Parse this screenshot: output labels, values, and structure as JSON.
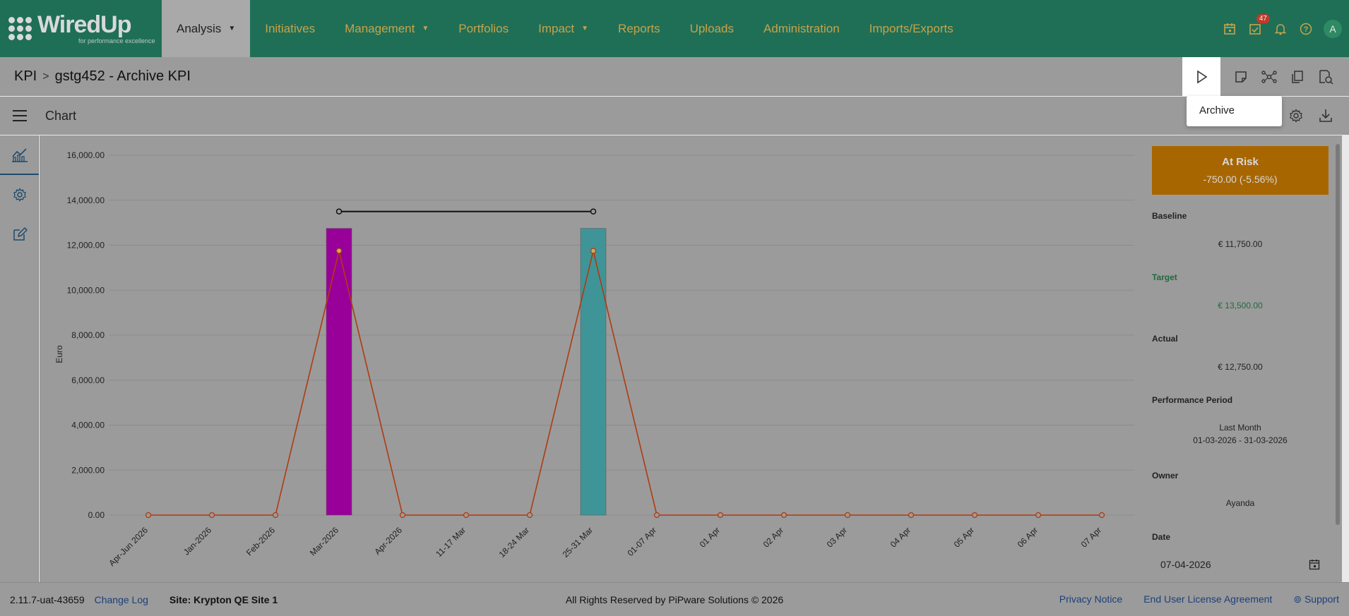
{
  "nav": {
    "logo_main": "WiredUp",
    "logo_sub": "for performance excellence",
    "items": [
      {
        "label": "Analysis",
        "dropdown": true,
        "active": true
      },
      {
        "label": "Initiatives",
        "dropdown": false
      },
      {
        "label": "Management",
        "dropdown": true
      },
      {
        "label": "Portfolios",
        "dropdown": false
      },
      {
        "label": "Impact",
        "dropdown": true
      },
      {
        "label": "Reports",
        "dropdown": false
      },
      {
        "label": "Uploads",
        "dropdown": false
      },
      {
        "label": "Administration",
        "dropdown": false
      },
      {
        "label": "Imports/Exports",
        "dropdown": false
      }
    ],
    "icons": [
      "calendar-icon",
      "task-icon",
      "bell-icon",
      "help-icon"
    ],
    "task_badge": "47",
    "avatar": "A",
    "accent": "#c8a24a",
    "brand": "#1f6f57"
  },
  "breadcrumb": {
    "root": "KPI",
    "current": "gstg452 - Archive KPI"
  },
  "toolbar": {
    "icons": [
      "play-icon",
      "note-icon",
      "network-icon",
      "copy-icon",
      "search-document-icon"
    ]
  },
  "popup": {
    "item": "Archive"
  },
  "chart_header": {
    "title": "Chart",
    "icons": [
      "settings-icon",
      "download-icon"
    ]
  },
  "sidebar": {
    "icons": [
      "chart-icon",
      "settings-icon",
      "edit-icon"
    ]
  },
  "chart_data": {
    "type": "bar",
    "ylabel": "Euro",
    "ylim": [
      0,
      16000
    ],
    "yticks": [
      "0.00",
      "2,000.00",
      "4,000.00",
      "6,000.00",
      "8,000.00",
      "10,000.00",
      "12,000.00",
      "14,000.00",
      "16,000.00"
    ],
    "categories": [
      "Apr-Jun 2026",
      "Jan-2026",
      "Feb-2026",
      "Mar-2026",
      "Apr-2026",
      "11-17 Mar",
      "18-24 Mar",
      "25-31 Mar",
      "01-07 Apr",
      "01 Apr",
      "02 Apr",
      "03 Apr",
      "04 Apr",
      "05 Apr",
      "06 Apr",
      "07 Apr"
    ],
    "series": [
      {
        "kind": "bar",
        "values": [
          null,
          null,
          null,
          12750,
          null,
          null,
          null,
          12750,
          null,
          null,
          null,
          null,
          null,
          null,
          null,
          null
        ],
        "colors": [
          "#990099",
          "#3f9497"
        ]
      },
      {
        "kind": "line",
        "color": "#b03a10",
        "values": [
          0,
          0,
          0,
          11750,
          0,
          0,
          0,
          11750,
          0,
          0,
          0,
          0,
          0,
          0,
          0,
          0
        ]
      },
      {
        "kind": "target-line",
        "color": "#111111",
        "from": "Mar-2026",
        "to": "25-31 Mar",
        "value": 13500
      }
    ],
    "grid": true
  },
  "panel": {
    "status": "At Risk",
    "status_value": "-750.00 (-5.56%)",
    "status_color": "#a86600",
    "baseline_label": "Baseline",
    "baseline_value": "€ 11,750.00",
    "target_label": "Target",
    "target_value": "€ 13,500.00",
    "actual_label": "Actual",
    "actual_value": "€ 12,750.00",
    "period_label": "Performance Period",
    "period_name": "Last Month",
    "period_range": "01-03-2026 - 31-03-2026",
    "owner_label": "Owner",
    "owner_value": "Ayanda",
    "date_label": "Date",
    "date_value": "07-04-2026"
  },
  "footer": {
    "version": "2.11.7-uat-43659",
    "changelog": "Change Log",
    "site": "Site: Krypton QE Site 1",
    "rights": "All Rights Reserved by PiPware Solutions © 2026",
    "privacy": "Privacy Notice",
    "eula": "End User License Agreement",
    "support": "Support"
  }
}
